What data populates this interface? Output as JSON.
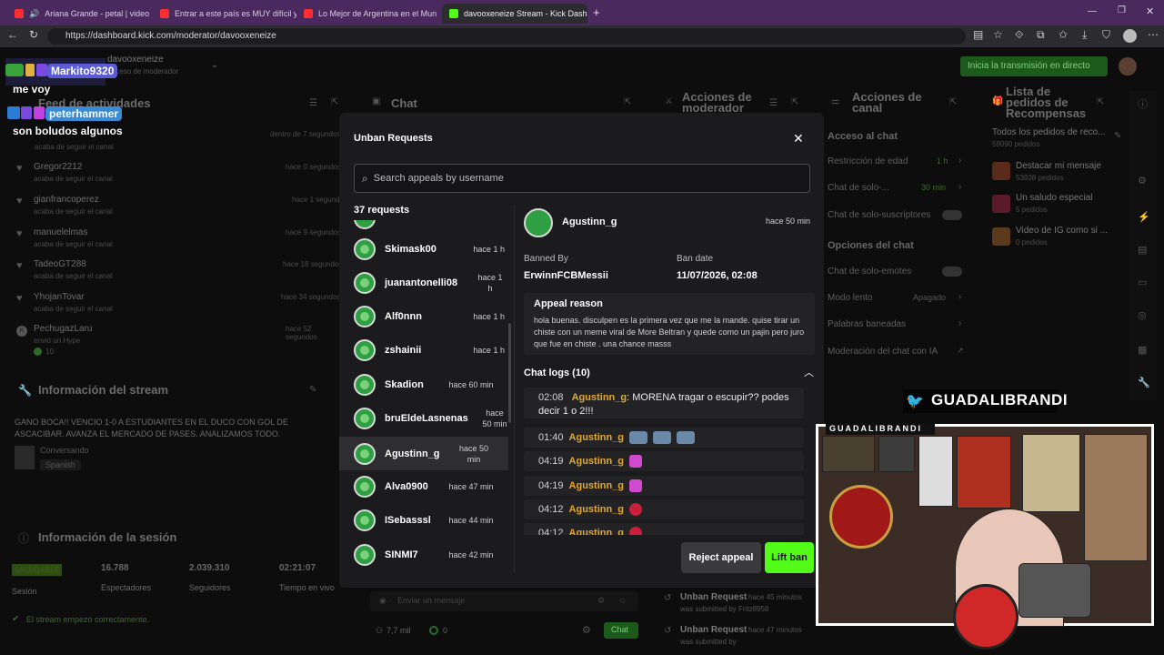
{
  "browser": {
    "tabs": [
      {
        "label": "Ariana Grande - petal | video",
        "color": "#ff2d2d"
      },
      {
        "label": "Entrar a este país es MUY difícil y",
        "color": "#ff2d2d"
      },
      {
        "label": "Lo Mejor de Argentina en el Mun",
        "color": "#ff2d2d"
      },
      {
        "label": "davooxeneize Stream - Kick Dashb",
        "color": "#53fc18"
      }
    ],
    "url": "https://dashboard.kick.com/moderator/davooxeneize"
  },
  "dashboard": {
    "channel": "davooxeneize",
    "channel_sub": "Acceso de moderador",
    "live_button": "Inicia la transmisión en directo",
    "activity_title": "Feed de actividades",
    "activity": [
      {
        "name": "Gregor2212",
        "sub": "acaba de seguir el canal",
        "time": "hace 0 segundos"
      },
      {
        "name": "gianfrancoperez",
        "sub": "acaba de seguir el canal",
        "time": "hace 1 segundo"
      },
      {
        "name": "manuelelmas",
        "sub": "acaba de seguir el canal",
        "time": "hace 9 segundos"
      },
      {
        "name": "TadeoGT288",
        "sub": "acaba de seguir el canal",
        "time": "hace 18 segundos"
      },
      {
        "name": "YhojanTovar",
        "sub": "acaba de seguir el canal",
        "time": "hace 34 segundos"
      },
      {
        "name": "PechugazLaru",
        "sub": "envió un Hype",
        "time": "hace 52 segundos"
      }
    ],
    "first_sub": "acaba de seguir el canal",
    "first_time": "dentro de 7 segundos",
    "hype_count": "10",
    "stream_info_title": "Información del stream",
    "stream_info_text": "GANO BOCA!! VENCIO 1-0 A ESTUDIANTES EN EL DUCO CON GOL DE ASCACIBAR. AVANZA EL MERCADO DE PASES. ANALIZAMOS TODO.",
    "stream_category": "Conversando",
    "stream_lang": "Spanish",
    "session_title": "Información de la sesión",
    "session": {
      "status": "SALUDABLE",
      "status_label": "Sesión",
      "viewers": "16.788",
      "viewers_label": "Espectadores",
      "followers": "2.039.310",
      "followers_label": "Seguidores",
      "time": "02:21:07",
      "time_label": "Tiempo en vivo"
    },
    "stream_ok": "El stream empezó correctamente.",
    "chat_title": "Chat",
    "chat_placeholder": "Enviar un mensaje",
    "chat_viewers": "7,7 mil",
    "chat_points": "0",
    "chat_button": "Chat",
    "mod_actions_title": "Acciones de moderador",
    "mod_actions": [
      {
        "title": "Unban Request",
        "time": "hace 45 minutos",
        "sub": "was submitted by Fritz8958"
      },
      {
        "title": "Unban Request",
        "time": "hace 47 minutos",
        "sub": "was submitted by"
      }
    ],
    "channel_actions_title": "Acciones de canal",
    "chat_access_title": "Acceso al chat",
    "chat_access": [
      {
        "label": "Restricción de edad",
        "value": "1 h"
      },
      {
        "label": "Chat de solo-...",
        "value": "30 min"
      },
      {
        "label": "Chat de solo-suscriptores",
        "value": ""
      }
    ],
    "chat_options_title": "Opciones del chat",
    "chat_options": [
      {
        "label": "Chat de solo-emotes",
        "value": ""
      },
      {
        "label": "Modo lento",
        "value": "Apagado"
      },
      {
        "label": "Palabras baneadas",
        "value": ""
      },
      {
        "label": "Moderación del chat con IA",
        "value": ""
      }
    ],
    "rewards_title": "Lista de pedidos de Recompensas",
    "rewards_all": "Todos los pedidos de reco...",
    "rewards_all_sub": "59090 pedidos",
    "rewards": [
      {
        "label": "Destacar mi mensaje",
        "sub": "53938 pedidos"
      },
      {
        "label": "Un saludo especial",
        "sub": "5 pedidos"
      },
      {
        "label": "Video de IG como si ...",
        "sub": "0 pedidos"
      }
    ]
  },
  "overlay_chat": [
    {
      "name": "Markito9320",
      "msg": "me voy"
    },
    {
      "name": "peterhammer",
      "msg": "son boludos algunos"
    }
  ],
  "streamer": {
    "handle": "GUADALIBRANDI",
    "banner": "GUADALIBRANDI"
  },
  "modal": {
    "title": "Unban Requests",
    "search_placeholder": "Search appeals by username",
    "count": "37 requests",
    "requests": [
      {
        "name": "Skimask00",
        "time": "hace 1 h"
      },
      {
        "name": "juanantonelli08",
        "time": "hace 1 h"
      },
      {
        "name": "Alf0nnn",
        "time": "hace 1 h"
      },
      {
        "name": "zshainii",
        "time": "hace 1 h"
      },
      {
        "name": "Skadion",
        "time": "hace 60 min"
      },
      {
        "name": "bruEldeLasnenas",
        "time": "hace 50 min"
      },
      {
        "name": "Agustinn_g",
        "time": "hace 50 min"
      },
      {
        "name": "Alva0900",
        "time": "hace 47 min"
      },
      {
        "name": "ISebasssl",
        "time": "hace 44 min"
      },
      {
        "name": "SINMI7",
        "time": "hace 42 min"
      }
    ],
    "detail": {
      "user": "Agustinn_g",
      "time": "hace 50 min",
      "banned_by_label": "Banned By",
      "banned_by": "ErwinnFCBMessii",
      "ban_date_label": "Ban date",
      "ban_date": "11/07/2026, 02:08",
      "appeal_label": "Appeal reason",
      "appeal_text": "hola buenas. disculpen es la primera vez que me la mande. quise tirar un chiste con un meme viral de More Beltran y quede como un pajin pero juro que fue en chiste . una chance masss",
      "logs_label": "Chat logs (10)",
      "logs": [
        {
          "time": "02:08",
          "user": "Agustinn_g",
          "msg": "MORENA tragar o escupir?? podes decir 1 o 2!!!"
        },
        {
          "time": "01:40",
          "user": "Agustinn_g",
          "msg": ""
        },
        {
          "time": "04:19",
          "user": "Agustinn_g",
          "msg": ""
        },
        {
          "time": "04:19",
          "user": "Agustinn_g",
          "msg": ""
        },
        {
          "time": "04:12",
          "user": "Agustinn_g",
          "msg": ""
        },
        {
          "time": "04:12",
          "user": "Agustinn_g",
          "msg": ""
        }
      ],
      "reject_label": "Reject appeal",
      "lift_label": "Lift ban"
    }
  }
}
